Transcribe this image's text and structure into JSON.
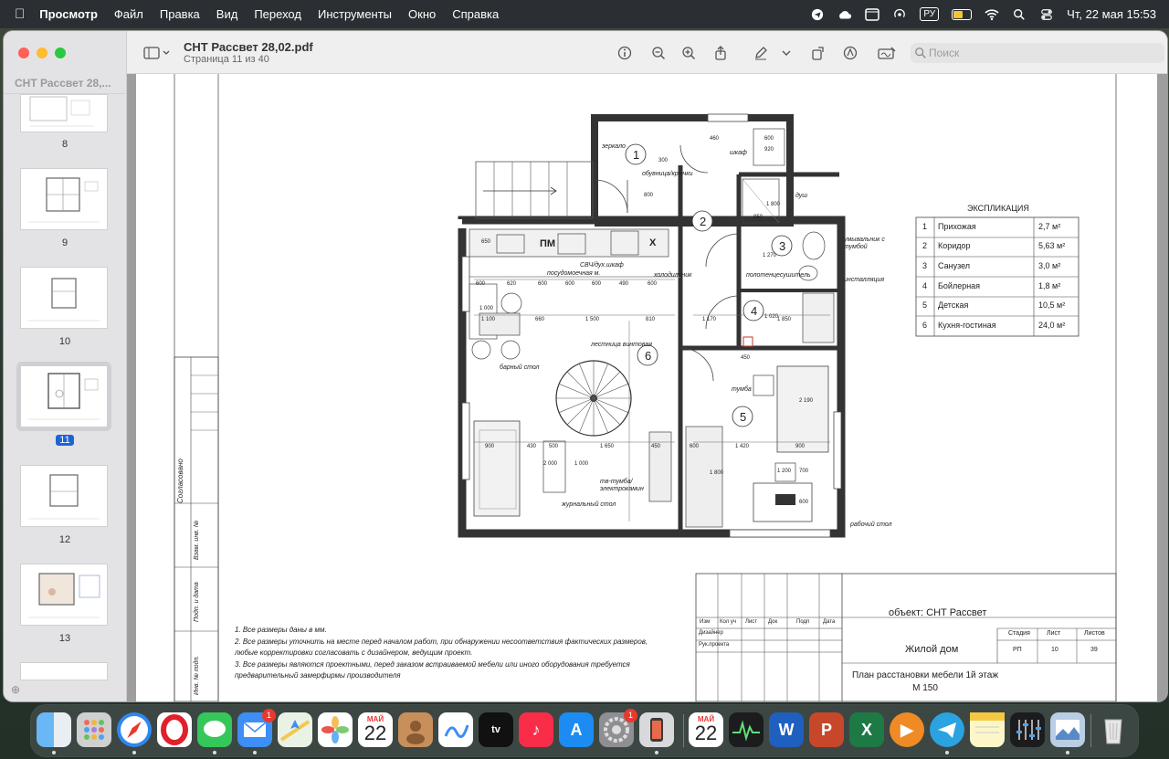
{
  "menubar": {
    "app_name": "Просмотр",
    "menus": [
      "Файл",
      "Правка",
      "Вид",
      "Переход",
      "Инструменты",
      "Окно",
      "Справка"
    ],
    "input_source": "РУ",
    "datetime": "Чт, 22 мая  15:53",
    "battery_level": 0.55
  },
  "window": {
    "sidebar_title": "СНТ Рассвет 28,...",
    "doc_title": "СНТ Рассвет 28,02.pdf",
    "doc_subtitle": "Страница 11 из 40",
    "search_placeholder": "Поиск",
    "thumbnails": [
      {
        "num": "8"
      },
      {
        "num": "9"
      },
      {
        "num": "10"
      },
      {
        "num": "11",
        "selected": true
      },
      {
        "num": "12"
      },
      {
        "num": "13"
      }
    ]
  },
  "plan": {
    "explication_title": "ЭКСПЛИКАЦИЯ",
    "rooms": [
      {
        "n": "1",
        "name": "Прихожая",
        "area": "2,7 м²"
      },
      {
        "n": "2",
        "name": "Коридор",
        "area": "5,63 м²"
      },
      {
        "n": "3",
        "name": "Санузел",
        "area": "3,0 м²"
      },
      {
        "n": "4",
        "name": "Бойлерная",
        "area": "1,8 м²"
      },
      {
        "n": "5",
        "name": "Детская",
        "area": "10,5 м²"
      },
      {
        "n": "6",
        "name": "Кухня-гостиная",
        "area": "24,0 м²"
      }
    ],
    "labels": {
      "mirror": "зеркало",
      "shoes": "обувница/крючки",
      "wardrobe": "шкаф",
      "shower": "душ",
      "sink": "умывальник с тумбой",
      "towel": "полотенцесушитель",
      "install": "инсталляция",
      "microwave": "СВЧ/дух.шкаф",
      "dishwasher": "посудомоечная м.",
      "fridge": "холодильник",
      "spiral": "лестница винтовая",
      "barstool": "барный стол",
      "nightstand": "тумба",
      "tvunit": "тв-тумба/ электрокамин",
      "coffee": "журнальный стол",
      "desk": "рабочий стол",
      "agreed": "Согласовано",
      "pm": "ПМ",
      "x": "Х"
    },
    "dims": [
      "460",
      "600",
      "920",
      "300",
      "800",
      "1 800",
      "850",
      "1 270",
      "1 020",
      "1 850",
      "1 170",
      "1 100",
      "660",
      "1 500",
      "810",
      "650",
      "620",
      "600",
      "600",
      "600",
      "490",
      "600",
      "600",
      "1 000",
      "900",
      "430",
      "500",
      "1 650",
      "450",
      "600",
      "1 420",
      "900",
      "2 000",
      "1 000",
      "2 190",
      "450",
      "1 200",
      "700",
      "600",
      "1 800"
    ],
    "notes": [
      "1. Все размеры даны в мм.",
      "2. Все размеры уточнить на месте перед началом работ, при обнаружении несоответствия фактических размеров,",
      "любые корректировки согласовать с дизайнером, ведущим  проект.",
      "3. Все размеры являются проектными, перед заказом встраиваемой мебели или иного оборудования требуется",
      "предварительный замерфирмы производителя"
    ],
    "stamp": {
      "object": "объект: СНТ Рассвет",
      "building": "Жилой дом",
      "sheet_title": "План расстановки мебели 1й этаж",
      "scale": "М 150",
      "cols": [
        "Изм",
        "Кол уч",
        "Лист",
        "Док",
        "Подп",
        "Дата"
      ],
      "designer": "Дизайнер",
      "head": "Рук.проекта",
      "stage_hdr": "Стадия",
      "sheet_hdr": "Лист",
      "sheets_hdr": "Листов",
      "stage": "РП",
      "sheet": "10",
      "sheets": "39",
      "side": [
        "Взам. инв. №",
        "Подп. и дата",
        "Инв. № подп."
      ]
    }
  },
  "dock": {
    "calendar_month": "МАЙ",
    "calendar_day": "22",
    "mail_badge": "1",
    "settings_badge": "1"
  }
}
